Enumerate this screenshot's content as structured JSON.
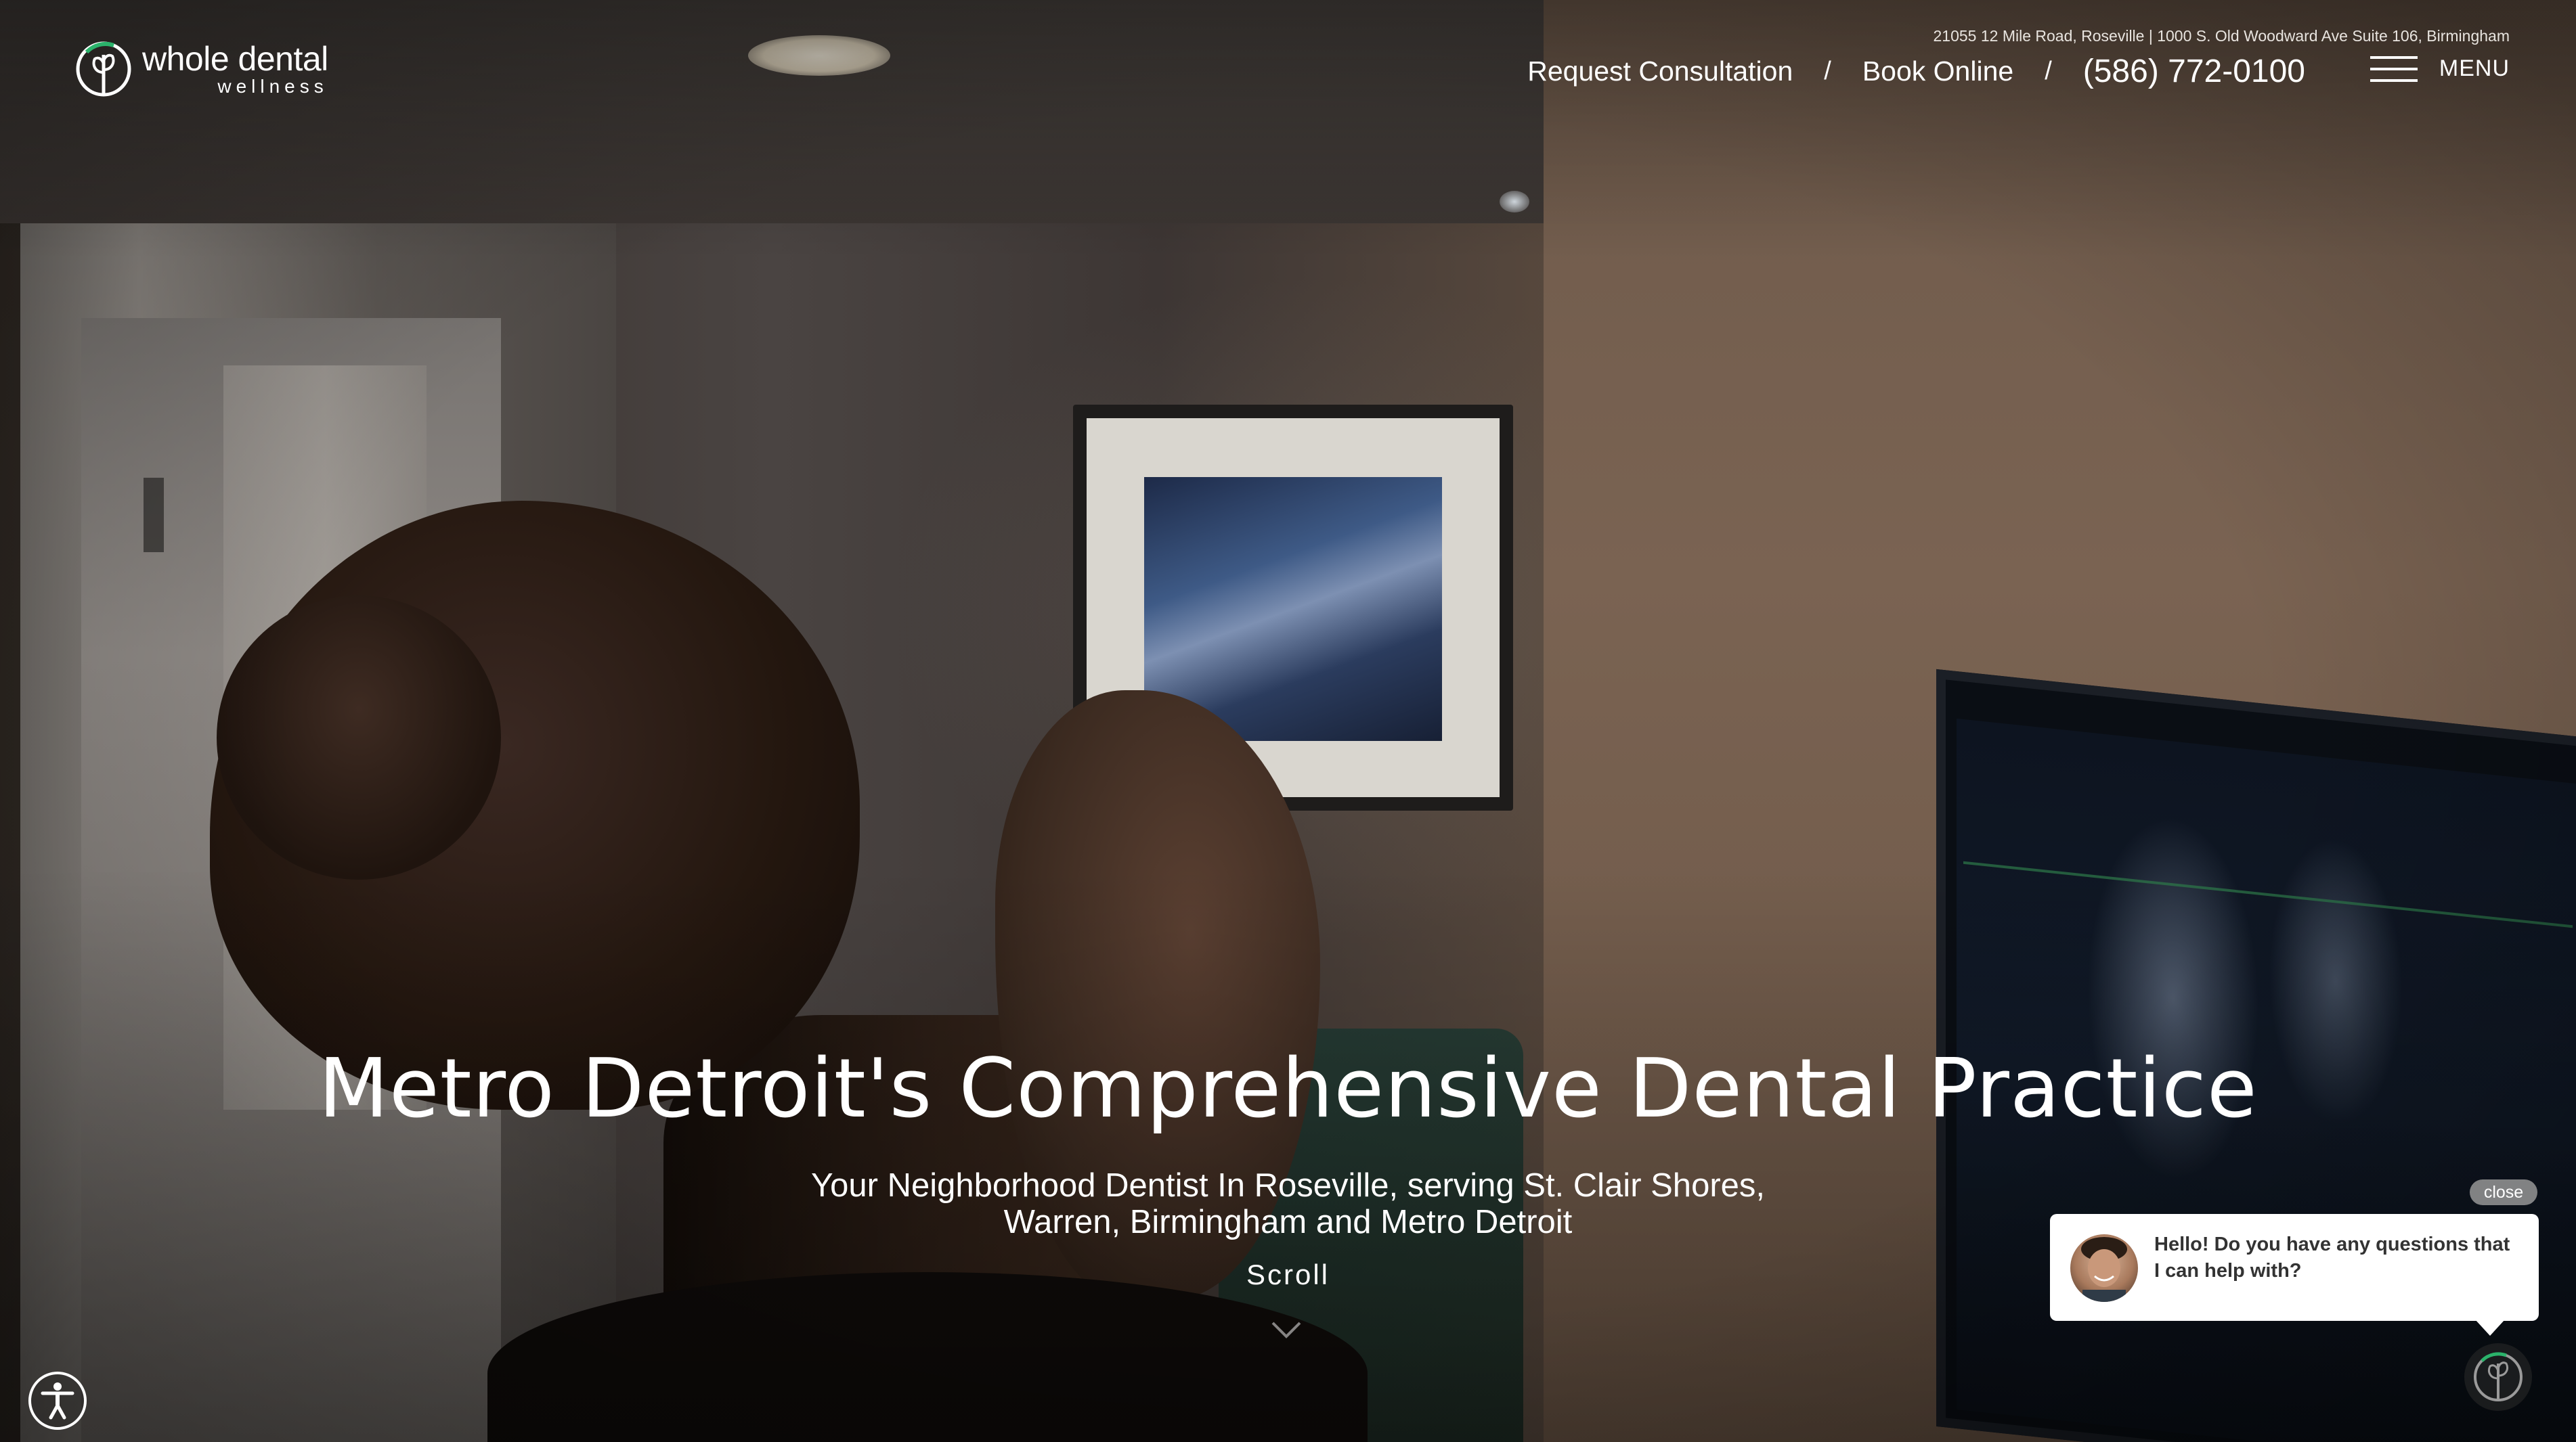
{
  "brand": {
    "name_line1": "whole dental",
    "name_line2": "wellness",
    "accent_color": "#2bb36b"
  },
  "header": {
    "address": "21055 12 Mile Road, Roseville | 1000 S. Old Woodward Ave Suite 106, Birmingham",
    "nav": {
      "request_consultation": "Request Consultation",
      "separator": "/",
      "book_online": "Book Online",
      "phone": "(586) 772-0100"
    },
    "menu_label": "MENU",
    "menu_icon": "hamburger-icon"
  },
  "hero": {
    "headline": "Metro Detroit's Comprehensive Dental Practice",
    "subhead_line1": "Your Neighborhood Dentist In Roseville, serving St. Clair Shores,",
    "subhead_line2": "Warren, Birmingham and Metro Detroit",
    "scroll_label": "Scroll",
    "scroll_icon": "chevron-down-icon"
  },
  "accessibility": {
    "icon": "accessibility-icon"
  },
  "chat": {
    "close_label": "close",
    "message": "Hello! Do you have any questions that I can help with?",
    "launcher_icon": "chat-logo-icon"
  }
}
